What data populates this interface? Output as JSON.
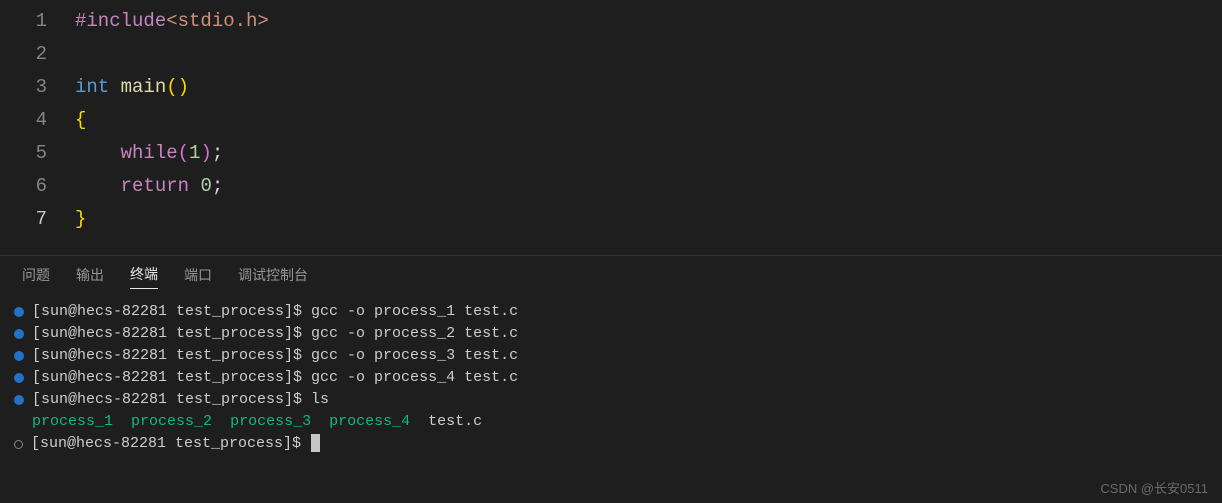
{
  "editor": {
    "lines": [
      {
        "num": "1",
        "tokens": [
          [
            "tk-macro",
            "#include"
          ],
          [
            "tk-include",
            "<stdio.h>"
          ]
        ]
      },
      {
        "num": "2",
        "tokens": []
      },
      {
        "num": "3",
        "tokens": [
          [
            "tk-type",
            "int"
          ],
          [
            "tk-punct",
            " "
          ],
          [
            "tk-func",
            "main"
          ],
          [
            "tk-paren",
            "("
          ],
          [
            "tk-paren",
            ")"
          ]
        ]
      },
      {
        "num": "4",
        "tokens": [
          [
            "tk-brace",
            "{"
          ]
        ]
      },
      {
        "num": "5",
        "tokens": [
          [
            "tk-punct",
            "    "
          ],
          [
            "tk-keyword",
            "while"
          ],
          [
            "tk-paren2",
            "("
          ],
          [
            "tk-num",
            "1"
          ],
          [
            "tk-paren2",
            ")"
          ],
          [
            "tk-punct",
            ";"
          ]
        ]
      },
      {
        "num": "6",
        "tokens": [
          [
            "tk-punct",
            "    "
          ],
          [
            "tk-keyword",
            "return"
          ],
          [
            "tk-punct",
            " "
          ],
          [
            "tk-num",
            "0"
          ],
          [
            "tk-punct",
            ";"
          ]
        ]
      },
      {
        "num": "7",
        "tokens": [
          [
            "tk-brace",
            "}"
          ]
        ]
      }
    ],
    "activeLine": 7
  },
  "panel": {
    "tabs": [
      {
        "label": "问题",
        "active": false
      },
      {
        "label": "输出",
        "active": false
      },
      {
        "label": "终端",
        "active": true
      },
      {
        "label": "端口",
        "active": false
      },
      {
        "label": "调试控制台",
        "active": false
      }
    ]
  },
  "terminal": {
    "lines": [
      {
        "bullet": "filled",
        "segments": [
          [
            "",
            "[sun@hecs-82281 test_process]$ gcc -o process_1 test.c"
          ]
        ]
      },
      {
        "bullet": "filled",
        "segments": [
          [
            "",
            "[sun@hecs-82281 test_process]$ gcc -o process_2 test.c"
          ]
        ]
      },
      {
        "bullet": "filled",
        "segments": [
          [
            "",
            "[sun@hecs-82281 test_process]$ gcc -o process_3 test.c"
          ]
        ]
      },
      {
        "bullet": "filled",
        "segments": [
          [
            "",
            "[sun@hecs-82281 test_process]$ gcc -o process_4 test.c"
          ]
        ]
      },
      {
        "bullet": "filled",
        "segments": [
          [
            "",
            "[sun@hecs-82281 test_process]$ ls"
          ]
        ]
      },
      {
        "bullet": "none",
        "segments": [
          [
            "exec",
            "process_1"
          ],
          [
            "",
            "  "
          ],
          [
            "exec",
            "process_2"
          ],
          [
            "",
            "  "
          ],
          [
            "exec",
            "process_3"
          ],
          [
            "",
            "  "
          ],
          [
            "exec",
            "process_4"
          ],
          [
            "",
            "  test.c"
          ]
        ]
      },
      {
        "bullet": "hollow",
        "segments": [
          [
            "",
            "[sun@hecs-82281 test_process]$ "
          ]
        ],
        "cursor": true
      }
    ]
  },
  "watermark": "CSDN @长安0511"
}
